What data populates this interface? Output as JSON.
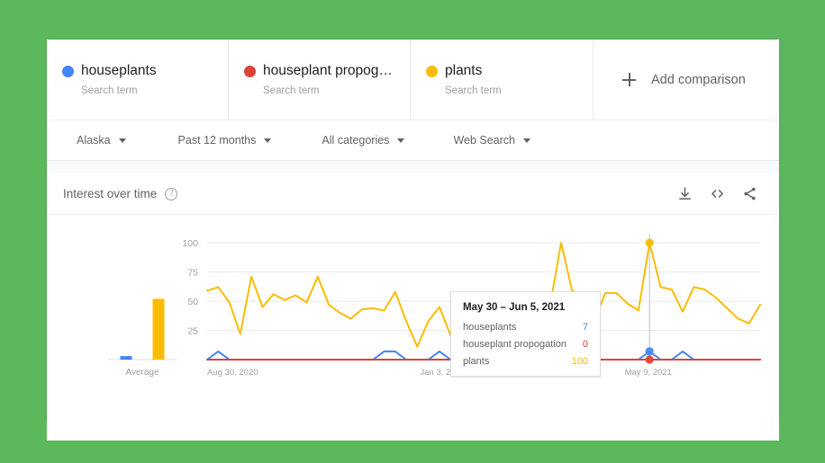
{
  "page": {
    "background_color": "#5cb85c",
    "card_background": "#ffffff"
  },
  "colors": {
    "series_blue": "#4285f4",
    "series_red": "#db4437",
    "series_yellow": "#f9ab00",
    "grid": "#e8eaed",
    "text_primary": "#202124",
    "text_secondary": "#5f6368",
    "text_muted": "#9aa0a6"
  },
  "terms": [
    {
      "label": "houseplants",
      "sublabel": "Search term",
      "dot_color": "#4285f4",
      "dot_name": "series-dot-blue"
    },
    {
      "label": "houseplant propog…",
      "sublabel": "Search term",
      "dot_color": "#db4437",
      "dot_name": "series-dot-red"
    },
    {
      "label": "plants",
      "sublabel": "Search term",
      "dot_color": "#fbbc04",
      "dot_name": "series-dot-yellow"
    }
  ],
  "add_comparison": {
    "label": "Add comparison",
    "icon": "plus-icon"
  },
  "filters": [
    {
      "label": "Alaska",
      "icon": "chevron-down-icon"
    },
    {
      "label": "Past 12 months",
      "icon": "chevron-down-icon"
    },
    {
      "label": "All categories",
      "icon": "chevron-down-icon"
    },
    {
      "label": "Web Search",
      "icon": "chevron-down-icon"
    }
  ],
  "panel": {
    "title": "Interest over time",
    "help_icon": "help-circle-icon",
    "help_glyph": "?",
    "actions": [
      {
        "name": "download-icon",
        "title": "Download"
      },
      {
        "name": "embed-code-icon",
        "title": "Embed"
      },
      {
        "name": "share-icon",
        "title": "Share"
      }
    ]
  },
  "average_panel": {
    "label": "Average",
    "bars": [
      {
        "series": "houseplants",
        "value": 3,
        "color": "#4285f4"
      },
      {
        "series": "houseplant propogation",
        "value": 0,
        "color": "#db4437"
      },
      {
        "series": "plants",
        "value": 52,
        "color": "#fbbc04"
      }
    ]
  },
  "tooltip": {
    "title": "May 30 – Jun 5, 2021",
    "rows": [
      {
        "label": "houseplants",
        "value": "7",
        "color": "#4285f4"
      },
      {
        "label": "houseplant propogation",
        "value": "0",
        "color": "#db4437"
      },
      {
        "label": "plants",
        "value": "100",
        "color": "#fbbc04"
      }
    ]
  },
  "chart_data": {
    "type": "line",
    "title": "Interest over time",
    "xlabel": "",
    "ylabel": "",
    "ylim": [
      0,
      100
    ],
    "yticks": [
      25,
      50,
      75,
      100
    ],
    "ytick_labels": [
      "25",
      "50",
      "75",
      "100"
    ],
    "grid": true,
    "legend": "top",
    "xtick_labels": [
      "Aug 30, 2020",
      "Jan 3, 2021",
      "May 9, 2021"
    ],
    "xtick_positions": [
      0,
      0.385,
      0.755
    ],
    "highlight_index": 40,
    "highlight_label": "May 30 – Jun 5, 2021",
    "series": [
      {
        "name": "plants",
        "color": "#fbbc04",
        "values": [
          59,
          62,
          49,
          22,
          71,
          45,
          56,
          51,
          55,
          49,
          71,
          47,
          40,
          35,
          43,
          44,
          42,
          58,
          33,
          11,
          33,
          45,
          21,
          44,
          50,
          44,
          54,
          43,
          56,
          46,
          40,
          46,
          100,
          59,
          54,
          33,
          57,
          57,
          48,
          42,
          100,
          62,
          60,
          41,
          62,
          60,
          53,
          44,
          35,
          31,
          47
        ]
      },
      {
        "name": "houseplants",
        "color": "#4285f4",
        "values": [
          0,
          7,
          0,
          0,
          0,
          0,
          0,
          0,
          0,
          0,
          0,
          0,
          0,
          0,
          0,
          0,
          7,
          7,
          0,
          0,
          0,
          7,
          0,
          0,
          0,
          0,
          0,
          7,
          0,
          7,
          0,
          7,
          0,
          0,
          0,
          0,
          0,
          0,
          0,
          0,
          7,
          0,
          0,
          7,
          0,
          0,
          0,
          0,
          0,
          0,
          0
        ]
      },
      {
        "name": "houseplant propogation",
        "color": "#db4437",
        "values": [
          0,
          0,
          0,
          0,
          0,
          0,
          0,
          0,
          0,
          0,
          0,
          0,
          0,
          0,
          0,
          0,
          0,
          0,
          0,
          0,
          0,
          0,
          0,
          0,
          0,
          0,
          0,
          0,
          0,
          0,
          0,
          0,
          0,
          0,
          0,
          0,
          0,
          0,
          0,
          0,
          0,
          0,
          0,
          0,
          0,
          0,
          0,
          0,
          0,
          0,
          0
        ]
      }
    ]
  }
}
